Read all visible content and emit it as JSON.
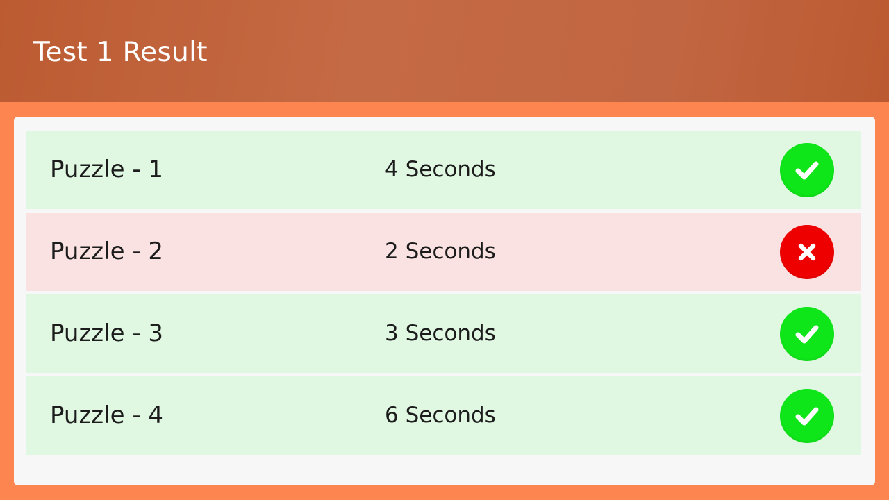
{
  "header": {
    "title": "Test 1 Result"
  },
  "results": [
    {
      "label": "Puzzle - 1",
      "time": "4 Seconds",
      "status": "pass",
      "icon": "check-icon"
    },
    {
      "label": "Puzzle - 2",
      "time": "2 Seconds",
      "status": "fail",
      "icon": "x-icon"
    },
    {
      "label": "Puzzle - 3",
      "time": "3 Seconds",
      "status": "pass",
      "icon": "check-icon"
    },
    {
      "label": "Puzzle - 4",
      "time": "6 Seconds",
      "status": "pass",
      "icon": "check-icon"
    }
  ],
  "colors": {
    "background": "#fc8550",
    "header": "#c16642",
    "pass_row": "#e0f7e2",
    "fail_row": "#fae2e2",
    "pass_icon": "#0fe619",
    "fail_icon": "#ee0000"
  }
}
